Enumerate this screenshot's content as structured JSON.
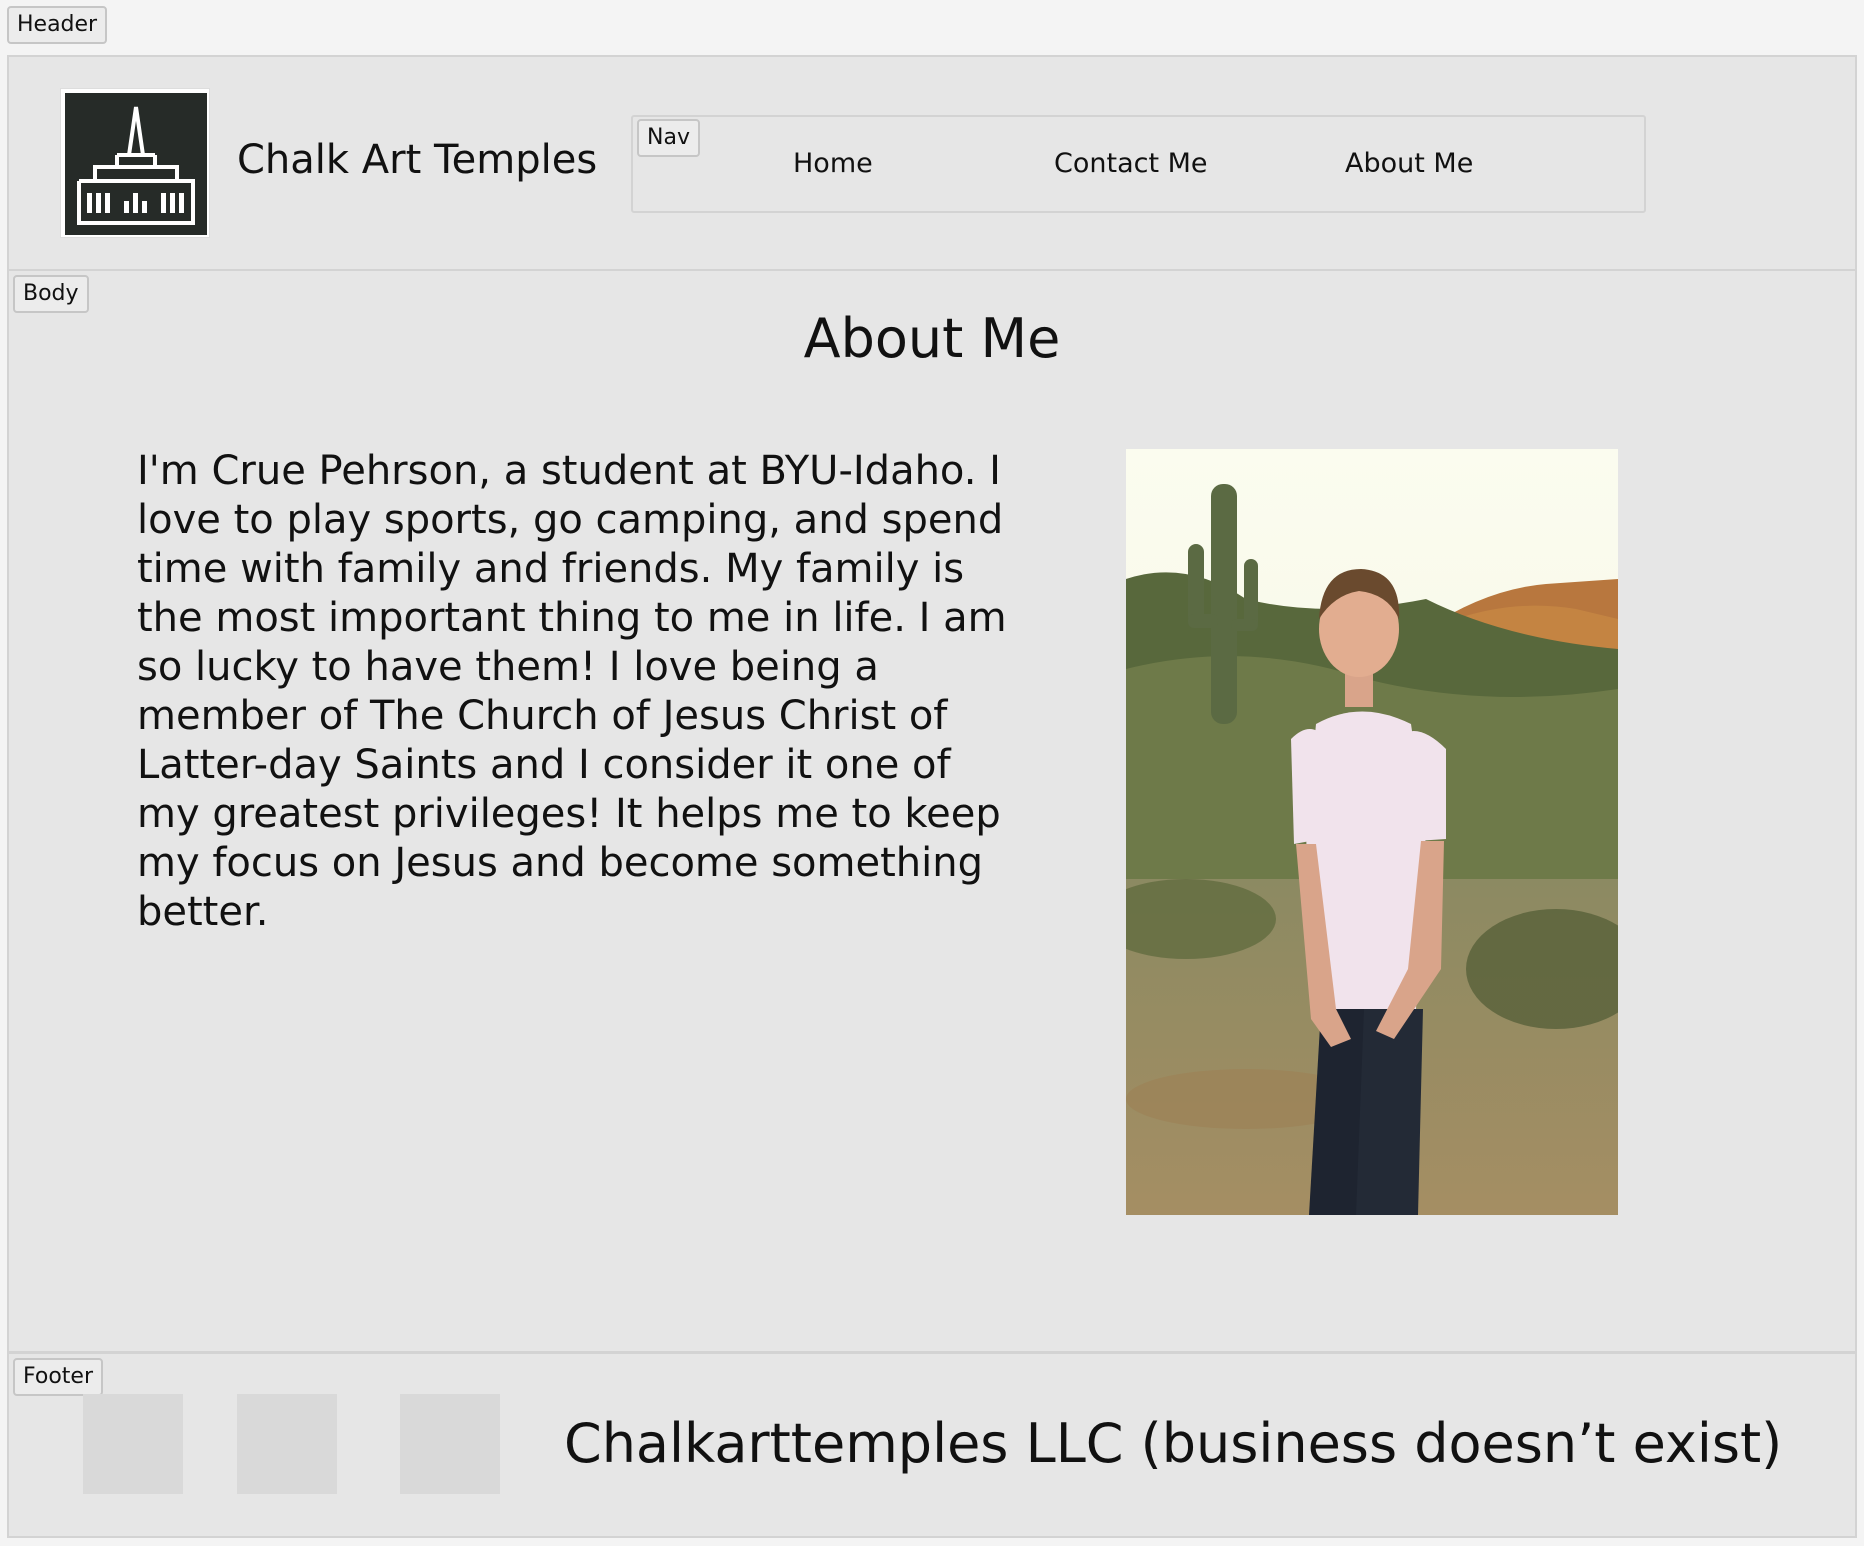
{
  "labels": {
    "header": "Header",
    "nav": "Nav",
    "body": "Body",
    "footer": "Footer"
  },
  "header": {
    "site_title": "Chalk Art Temples"
  },
  "nav": {
    "items": [
      {
        "label": "Home"
      },
      {
        "label": "Contact Me"
      },
      {
        "label": "About Me"
      }
    ]
  },
  "main": {
    "heading": "About Me",
    "bio": "I'm Crue Pehrson, a student at BYU-Idaho.  I love to play sports, go camping, and spend time with family and friends. My family is the most important thing to me in life.  I am so lucky to have them! I love being a member of The Church of Jesus Christ of Latter-day Saints and I consider it one of my greatest privileges! It helps me to keep my focus on Jesus and become something better."
  },
  "footer": {
    "copyright": "Chalkarttemples LLC (business doesn’t exist)"
  },
  "colors": {
    "page_bg": "#f4f4f4",
    "section_bg": "#e6e6e6",
    "logo_bg": "#262b28",
    "placeholder": "#d9d9d9"
  }
}
